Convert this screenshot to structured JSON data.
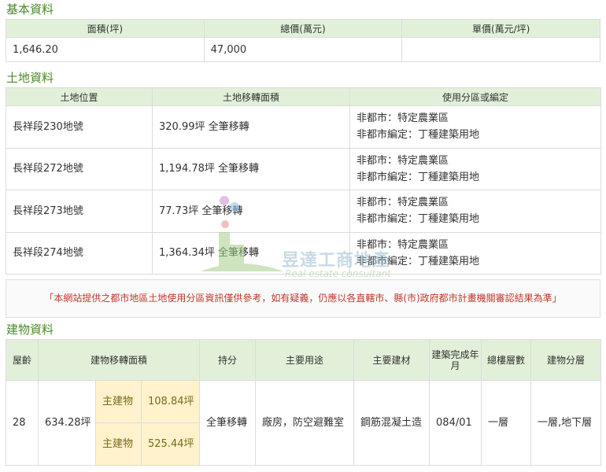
{
  "basic": {
    "title": "基本資料",
    "headers": [
      "面積(坪)",
      "總價(萬元)",
      "單價(萬元/坪)"
    ],
    "values": [
      "1,646.20",
      "47,000",
      ""
    ]
  },
  "land": {
    "title": "土地資料",
    "headers": [
      "土地位置",
      "土地移轉面積",
      "使用分區或編定"
    ],
    "rows": [
      {
        "location": "長祥段230地號",
        "area": "320.99坪 全筆移轉",
        "zone": "非都市：特定農業區",
        "designation": "非都市編定：丁種建築用地"
      },
      {
        "location": "長祥段272地號",
        "area": "1,194.78坪 全筆移轉",
        "zone": "非都市：特定農業區",
        "designation": "非都市編定：丁種建築用地"
      },
      {
        "location": "長祥段273地號",
        "area": "77.73坪 全筆移轉",
        "zone": "非都市：特定農業區",
        "designation": "非都市編定：丁種建築用地"
      },
      {
        "location": "長祥段274地號",
        "area": "1,364.34坪 全筆移轉",
        "zone": "非都市：特定農業區",
        "designation": "非都市編定：丁種建築用地"
      }
    ]
  },
  "notice": "「本網站提供之都市地區土地使用分區資訊僅供參考，如有疑義，仍應以各直轄市、縣(市)政府都市計畫機關審認結果為準」",
  "building": {
    "title": "建物資料",
    "headers": {
      "age": "屋齡",
      "area": "建物移轉面積",
      "share": "持分",
      "usage": "主要用途",
      "material": "主要建材",
      "completed": "建築完成年月",
      "floors": "總樓層數",
      "levels": "建物分層"
    },
    "row": {
      "age": "28",
      "total_area": "634.28坪",
      "parts": [
        {
          "label": "主建物",
          "area": "108.84坪"
        },
        {
          "label": "主建物",
          "area": "525.44坪"
        }
      ],
      "share": "全筆移轉",
      "usage": "廠房，防空避難室",
      "material": "鋼筋混凝土造",
      "completed": "084/01",
      "floors": "一層",
      "levels": "一層,地下層"
    }
  },
  "watermark": {
    "name": "昱達工商地產",
    "sub": "Real estate consultant"
  },
  "colors": {
    "accent": "#4a8a2c",
    "header_bg": "#e2f0d9",
    "highlight_bg": "#fff2cc",
    "notice_text": "#c0392b"
  }
}
